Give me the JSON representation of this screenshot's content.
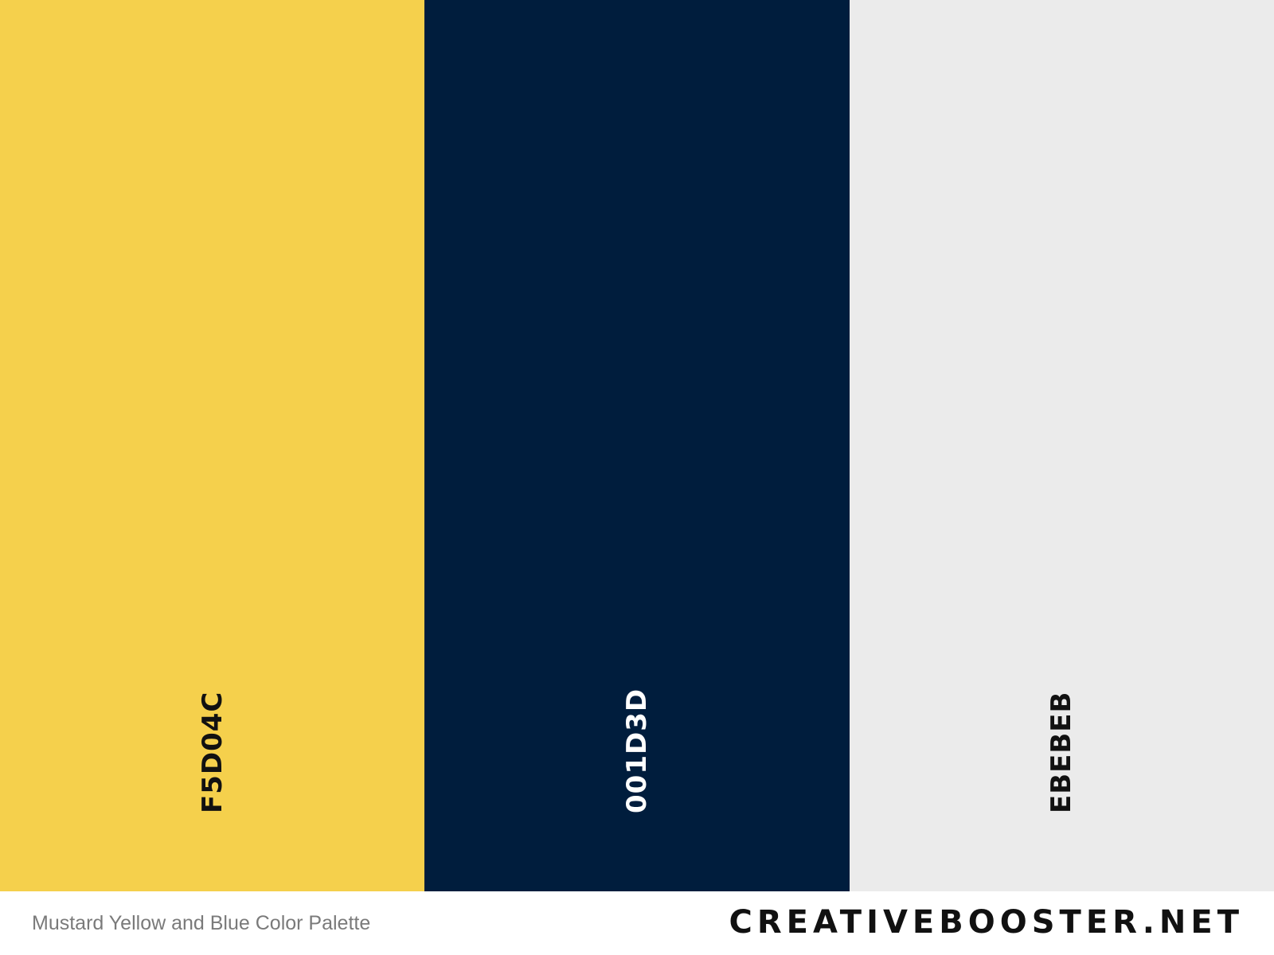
{
  "palette": {
    "swatches": [
      {
        "hex": "F5D04C",
        "color": "#F5D04C",
        "text_color": "#111111"
      },
      {
        "hex": "001D3D",
        "color": "#001D3D",
        "text_color": "#FFFFFF"
      },
      {
        "hex": "EBEBEB",
        "color": "#EBEBEB",
        "text_color": "#111111"
      }
    ]
  },
  "footer": {
    "caption": "Mustard Yellow and Blue Color Palette",
    "brand": "CREATIVEBOOSTER.NET"
  }
}
